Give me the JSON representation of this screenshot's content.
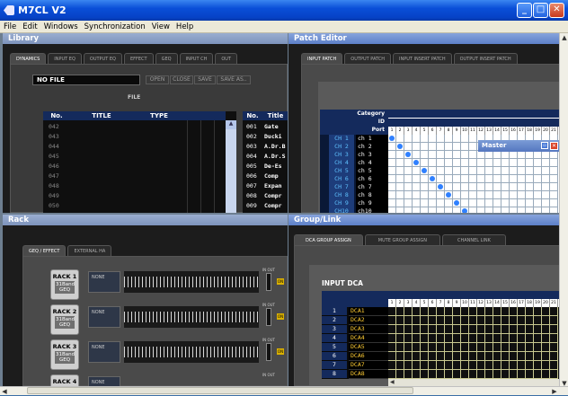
{
  "window": {
    "title": "M7CL V2",
    "min": "_",
    "max": "□",
    "close": "✕"
  },
  "menu": [
    "File",
    "Edit",
    "Windows",
    "Synchronization",
    "View",
    "Help"
  ],
  "library": {
    "title": "Library",
    "tabs": [
      "DYNAMICS",
      "INPUT EQ",
      "OUTPUT EQ",
      "EFFECT",
      "GEQ",
      "INPUT CH",
      "OUT"
    ],
    "file_name": "NO FILE",
    "buttons": [
      "OPEN",
      "CLOSE",
      "SAVE",
      "SAVE AS.."
    ],
    "file_label": "FILE",
    "table_headers": [
      "No.",
      "TITLE",
      "TYPE"
    ],
    "rows": [
      "042",
      "043",
      "044",
      "045",
      "046",
      "047",
      "048",
      "049",
      "050"
    ],
    "right_headers": [
      "No.",
      "Title"
    ],
    "right_rows": [
      {
        "no": "001",
        "title": "Gate"
      },
      {
        "no": "002",
        "title": "Ducki"
      },
      {
        "no": "003",
        "title": "A.Dr.B"
      },
      {
        "no": "004",
        "title": "A.Dr.S"
      },
      {
        "no": "005",
        "title": "De-Es"
      },
      {
        "no": "006",
        "title": "Comp"
      },
      {
        "no": "007",
        "title": "Expan"
      },
      {
        "no": "008",
        "title": "Compr"
      },
      {
        "no": "009",
        "title": "Compr"
      }
    ]
  },
  "patch": {
    "title": "Patch Editor",
    "tabs": [
      "INPUT PATCH",
      "OUTPUT PATCH",
      "INPUT INSERT PATCH",
      "OUTPUT INSERT PATCH"
    ],
    "labels": [
      "Category",
      "ID",
      "Port"
    ],
    "ports": [
      "1",
      "2",
      "3",
      "4",
      "5",
      "6",
      "7",
      "8",
      "9",
      "10",
      "11",
      "12",
      "13",
      "14",
      "15",
      "16",
      "17",
      "18",
      "19",
      "20",
      "21"
    ],
    "channels": [
      {
        "ch": "CH 1",
        "name": "ch 1"
      },
      {
        "ch": "CH 2",
        "name": "ch 2"
      },
      {
        "ch": "CH 3",
        "name": "ch 3"
      },
      {
        "ch": "CH 4",
        "name": "ch 4"
      },
      {
        "ch": "CH 5",
        "name": "ch 5"
      },
      {
        "ch": "CH 6",
        "name": "ch 6"
      },
      {
        "ch": "CH 7",
        "name": "ch 7"
      },
      {
        "ch": "CH 8",
        "name": "ch 8"
      },
      {
        "ch": "CH 9",
        "name": "ch 9"
      },
      {
        "ch": "CH10",
        "name": "ch10"
      }
    ],
    "mini_window": "Master"
  },
  "rack": {
    "title": "Rack",
    "tabs": [
      "GEQ / EFFECT",
      "EXTERNAL HA"
    ],
    "units": [
      {
        "name": "RACK 1",
        "type": "31Band GEQ",
        "sel": "NONE"
      },
      {
        "name": "RACK 2",
        "type": "31Band GEQ",
        "sel": "NONE"
      },
      {
        "name": "RACK 3",
        "type": "31Band GEQ",
        "sel": "NONE"
      },
      {
        "name": "RACK 4",
        "type": "",
        "sel": "NONE"
      }
    ],
    "io": "IN OUT",
    "on": "ON"
  },
  "group": {
    "title": "Group/Link",
    "tabs": [
      "DCA GROUP ASSIGN",
      "MUTE GROUP ASSIGN",
      "CHANNEL LINK"
    ],
    "section": "INPUT DCA",
    "ports": [
      "1",
      "2",
      "3",
      "4",
      "5",
      "6",
      "7",
      "8",
      "9",
      "10",
      "11",
      "12",
      "13",
      "14",
      "15",
      "16",
      "17",
      "18",
      "19",
      "20",
      "21"
    ],
    "dcas": [
      {
        "n": "1",
        "name": "DCA1"
      },
      {
        "n": "2",
        "name": "DCA2"
      },
      {
        "n": "3",
        "name": "DCA3"
      },
      {
        "n": "4",
        "name": "DCA4"
      },
      {
        "n": "5",
        "name": "DCA5"
      },
      {
        "n": "6",
        "name": "DCA6"
      },
      {
        "n": "7",
        "name": "DCA7"
      },
      {
        "n": "8",
        "name": "DCA8"
      }
    ]
  },
  "colors": {
    "accent": "#2f80ff",
    "grid_yellow": "#c8c890",
    "dca_text": "#ffcc33"
  }
}
